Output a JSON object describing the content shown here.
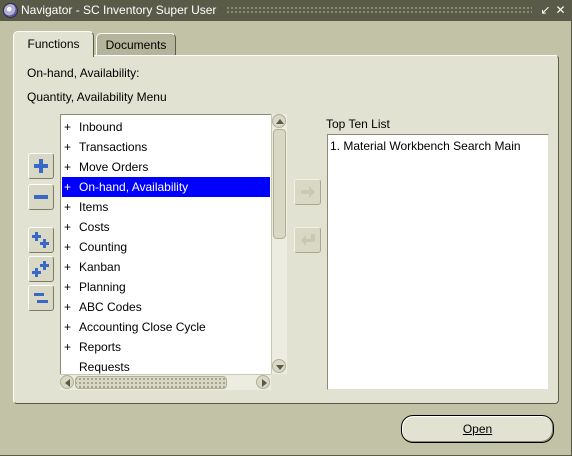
{
  "window": {
    "title": "Navigator - SC Inventory Super User",
    "controls": {
      "minimize": "↙",
      "close": "✕"
    }
  },
  "tabs": [
    {
      "label": "Functions",
      "active": true
    },
    {
      "label": "Documents",
      "active": false
    }
  ],
  "header": {
    "line1": "On-hand, Availability:",
    "line2": "Quantity, Availability Menu"
  },
  "side_buttons": [
    {
      "name": "expand-icon"
    },
    {
      "name": "collapse-icon"
    },
    {
      "name": "expand-branch-icon"
    },
    {
      "name": "expand-all-icon"
    },
    {
      "name": "collapse-all-icon"
    }
  ],
  "tree": {
    "items": [
      {
        "prefix": "+",
        "label": "Inbound",
        "selected": false
      },
      {
        "prefix": "+",
        "label": "Transactions",
        "selected": false
      },
      {
        "prefix": "+",
        "label": "Move Orders",
        "selected": false
      },
      {
        "prefix": "+",
        "label": "On-hand, Availability",
        "selected": true
      },
      {
        "prefix": "+",
        "label": "Items",
        "selected": false
      },
      {
        "prefix": "+",
        "label": "Costs",
        "selected": false
      },
      {
        "prefix": "+",
        "label": "Counting",
        "selected": false
      },
      {
        "prefix": "+",
        "label": "Kanban",
        "selected": false
      },
      {
        "prefix": "+",
        "label": "Planning",
        "selected": false
      },
      {
        "prefix": "+",
        "label": "ABC Codes",
        "selected": false
      },
      {
        "prefix": "+",
        "label": "Accounting Close Cycle",
        "selected": false
      },
      {
        "prefix": "+",
        "label": "Reports",
        "selected": false
      },
      {
        "prefix": "",
        "label": "Requests",
        "selected": false
      }
    ]
  },
  "top_ten": {
    "label": "Top Ten List",
    "items": [
      "1. Material Workbench Search Main"
    ]
  },
  "buttons": {
    "open": "Open"
  },
  "colors": {
    "window_bg": "#c2c2a6",
    "panel_bg": "#e2e2d2",
    "titlebar": "#5a5a48",
    "selection": "#0000ff",
    "icon_blue": "#3868c8"
  }
}
